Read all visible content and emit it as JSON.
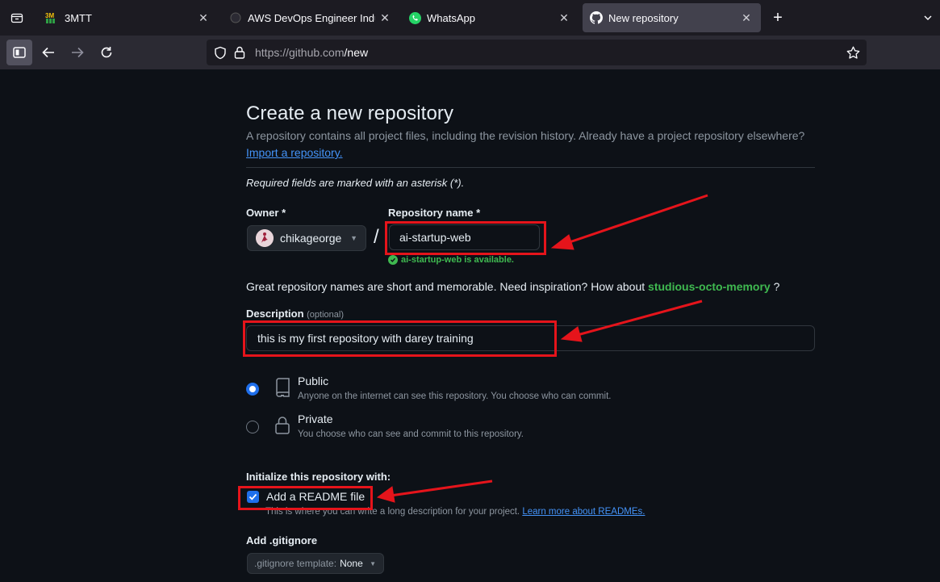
{
  "browser": {
    "tabs": [
      {
        "label": "3MTT",
        "icon": "3mtt-favicon"
      },
      {
        "label": "AWS DevOps Engineer Industria",
        "icon": "aws-favicon"
      },
      {
        "label": "WhatsApp",
        "icon": "whatsapp-favicon"
      },
      {
        "label": "New repository",
        "icon": "github-favicon",
        "active": true
      }
    ],
    "new_tab": "+",
    "url_host": "https://github.com",
    "url_path": "/new"
  },
  "page": {
    "title": "Create a new repository",
    "subtitle": "A repository contains all project files, including the revision history. Already have a project repository elsewhere?",
    "import_link": "Import a repository.",
    "required_note": "Required fields are marked with an asterisk (*).",
    "owner_label": "Owner *",
    "owner_value": "chikageorge",
    "repo_name_label": "Repository name *",
    "repo_name_value": "ai-startup-web",
    "availability": "ai-startup-web is available.",
    "inspiration_text": "Great repository names are short and memorable. Need inspiration? How about",
    "inspiration_suggestion": "studious-octo-memory",
    "inspiration_end": "?",
    "description_label": "Description",
    "description_optional": "(optional)",
    "description_value": "this is my first repository with darey training",
    "visibility": [
      {
        "title": "Public",
        "desc": "Anyone on the internet can see this repository. You choose who can commit.",
        "selected": true
      },
      {
        "title": "Private",
        "desc": "You choose who can see and commit to this repository.",
        "selected": false
      }
    ],
    "init_label": "Initialize this repository with:",
    "readme_label": "Add a README file",
    "readme_checked": true,
    "readme_desc": "This is where you can write a long description for your project.",
    "readme_learn": "Learn more about READMEs.",
    "gitignore_label": "Add .gitignore",
    "gitignore_prefix": ".gitignore template:",
    "gitignore_value": "None"
  },
  "colors": {
    "annotation": "#e5141b",
    "accent": "#1f6feb",
    "success": "#3fb950",
    "link": "#4493f8"
  }
}
